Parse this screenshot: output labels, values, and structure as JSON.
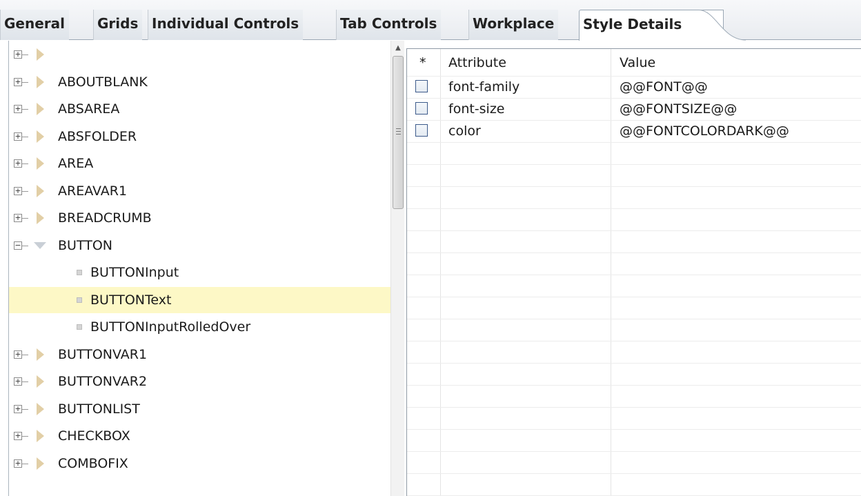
{
  "tabs": [
    {
      "label": "General",
      "active": false
    },
    {
      "label": "Grids",
      "active": false
    },
    {
      "label": "Individual Controls",
      "active": false
    },
    {
      "label": "Tab Controls",
      "active": false
    },
    {
      "label": "Workplace",
      "active": false
    },
    {
      "label": "Style Details",
      "active": true
    }
  ],
  "tree": {
    "items": [
      {
        "label": "",
        "level": 0,
        "state": "collapsed"
      },
      {
        "label": "ABOUTBLANK",
        "level": 0,
        "state": "collapsed"
      },
      {
        "label": "ABSAREA",
        "level": 0,
        "state": "collapsed"
      },
      {
        "label": "ABSFOLDER",
        "level": 0,
        "state": "collapsed"
      },
      {
        "label": "AREA",
        "level": 0,
        "state": "collapsed"
      },
      {
        "label": "AREAVAR1",
        "level": 0,
        "state": "collapsed"
      },
      {
        "label": "BREADCRUMB",
        "level": 0,
        "state": "collapsed"
      },
      {
        "label": "BUTTON",
        "level": 0,
        "state": "expanded"
      },
      {
        "label": "BUTTONInput",
        "level": 1,
        "state": "leaf"
      },
      {
        "label": "BUTTONText",
        "level": 1,
        "state": "leaf",
        "selected": true
      },
      {
        "label": "BUTTONInputRolledOver",
        "level": 1,
        "state": "leaf"
      },
      {
        "label": "BUTTONVAR1",
        "level": 0,
        "state": "collapsed"
      },
      {
        "label": "BUTTONVAR2",
        "level": 0,
        "state": "collapsed"
      },
      {
        "label": "BUTTONLIST",
        "level": 0,
        "state": "collapsed"
      },
      {
        "label": "CHECKBOX",
        "level": 0,
        "state": "collapsed"
      },
      {
        "label": "COMBOFIX",
        "level": 0,
        "state": "collapsed"
      }
    ],
    "selected_color": "#fdf8c6",
    "collapsed_icon": "triangle-right-icon",
    "expanded_icon": "triangle-down-icon"
  },
  "attributes": {
    "headers": {
      "star": "*",
      "attribute": "Attribute",
      "value": "Value"
    },
    "rows": [
      {
        "attribute": "font-family",
        "value": "@@FONT@@",
        "checked": false
      },
      {
        "attribute": "font-size",
        "value": "@@FONTSIZE@@",
        "checked": false
      },
      {
        "attribute": "color",
        "value": "@@FONTCOLORDARK@@",
        "checked": false
      }
    ]
  }
}
